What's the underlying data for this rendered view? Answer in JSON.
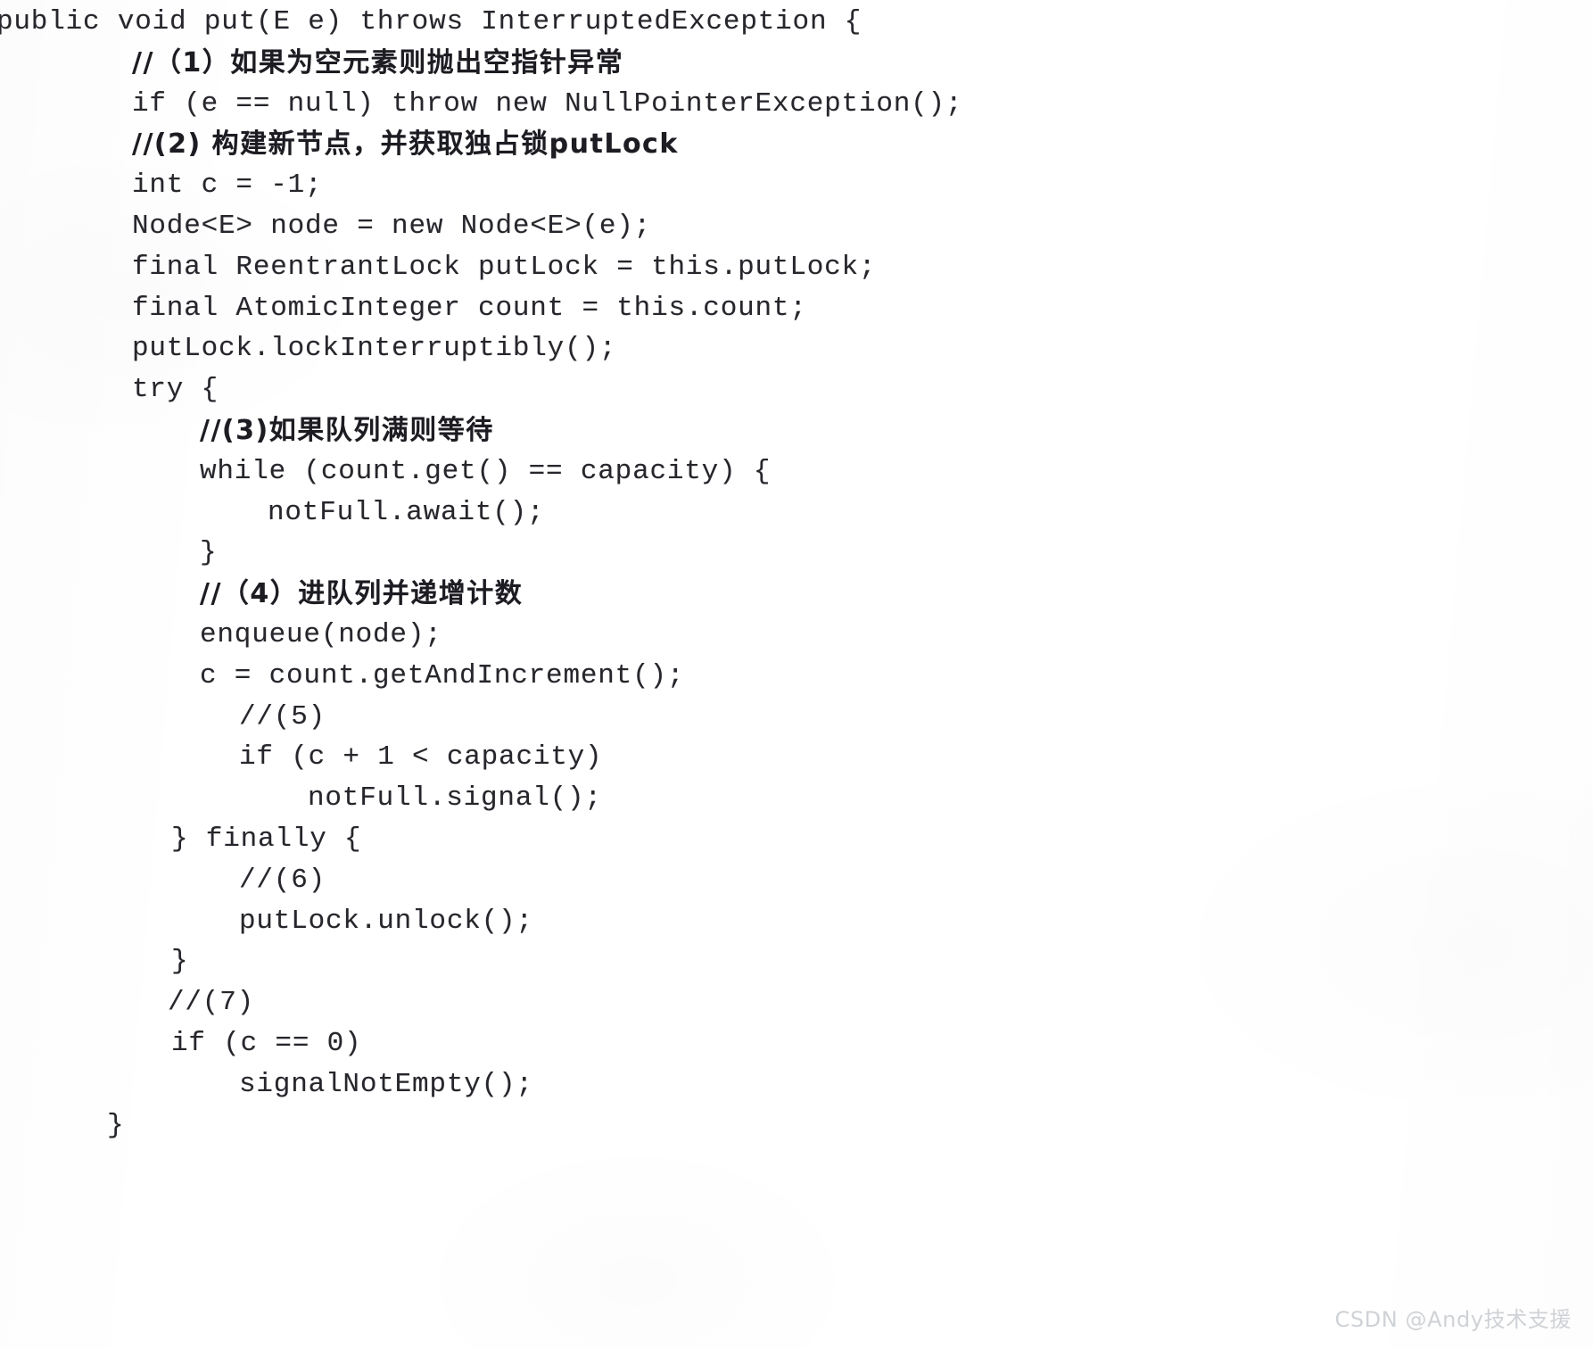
{
  "document": {
    "kind": "scanned-book-page",
    "language": "Java",
    "background_color": "#ffffff",
    "text_color": "#26262c"
  },
  "code": {
    "lines": [
      {
        "indent": -4,
        "text": "public void put(E e) throws InterruptedException {",
        "script": "code"
      },
      {
        "indent": 148,
        "text": "//（1）如果为空元素则抛出空指针异常",
        "script": "cjk"
      },
      {
        "indent": 148,
        "text": "if (e == null) throw new NullPointerException();",
        "script": "code"
      },
      {
        "indent": 148,
        "text": "//(2) 构建新节点，并获取独占锁putLock",
        "script": "cjk"
      },
      {
        "indent": 148,
        "text": "int c = -1;",
        "script": "code"
      },
      {
        "indent": 148,
        "text": "Node<E> node = new Node<E>(e);",
        "script": "code"
      },
      {
        "indent": 148,
        "text": "final ReentrantLock putLock = this.putLock;",
        "script": "code"
      },
      {
        "indent": 148,
        "text": "final AtomicInteger count = this.count;",
        "script": "code"
      },
      {
        "indent": 148,
        "text": "putLock.lockInterruptibly();",
        "script": "code"
      },
      {
        "indent": 148,
        "text": "try {",
        "script": "code"
      },
      {
        "indent": 224,
        "text": "//(3)如果队列满则等待",
        "script": "cjk"
      },
      {
        "indent": 224,
        "text": "while (count.get() == capacity) {",
        "script": "code"
      },
      {
        "indent": 300,
        "text": "notFull.await();",
        "script": "code"
      },
      {
        "indent": 224,
        "text": "}",
        "script": "code"
      },
      {
        "indent": 224,
        "text": "//（4）进队列并递增计数",
        "script": "cjk"
      },
      {
        "indent": 224,
        "text": "enqueue(node);",
        "script": "code"
      },
      {
        "indent": 224,
        "text": "c = count.getAndIncrement();",
        "script": "code"
      },
      {
        "indent": 268,
        "text": "//(5)",
        "script": "code"
      },
      {
        "indent": 268,
        "text": "if (c + 1 < capacity)",
        "script": "code"
      },
      {
        "indent": 345,
        "text": "notFull.signal();",
        "script": "code"
      },
      {
        "indent": 192,
        "text": "} finally {",
        "script": "code"
      },
      {
        "indent": 268,
        "text": "//(6)",
        "script": "code"
      },
      {
        "indent": 268,
        "text": "putLock.unlock();",
        "script": "code"
      },
      {
        "indent": 192,
        "text": "}",
        "script": "code"
      },
      {
        "indent": 188,
        "text": "//(7)",
        "script": "code"
      },
      {
        "indent": 192,
        "text": "if (c == 0)",
        "script": "code"
      },
      {
        "indent": 268,
        "text": "signalNotEmpty();",
        "script": "code"
      },
      {
        "indent": 120,
        "text": "}",
        "script": "code"
      }
    ]
  },
  "watermark": {
    "text": "CSDN @Andy技术支援",
    "color": "#cfd2d6"
  }
}
